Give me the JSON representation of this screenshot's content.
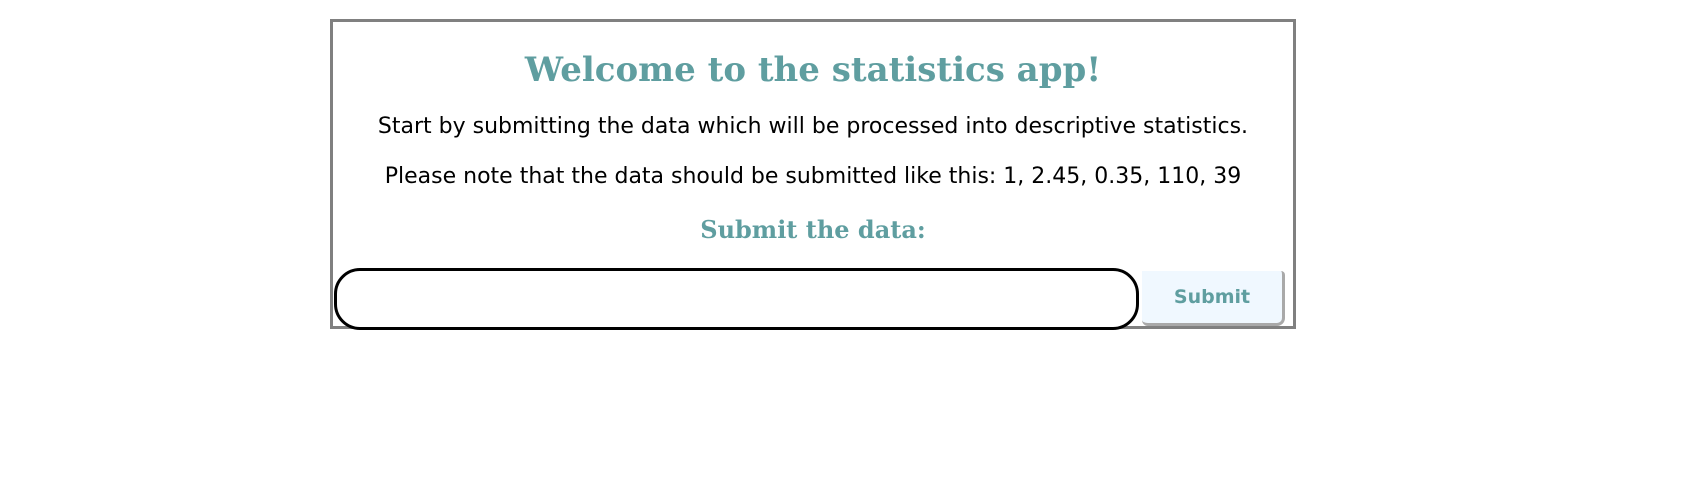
{
  "card": {
    "title": "Welcome to the statistics app!",
    "intro": "Start by submitting the data which will be processed into descriptive statistics.",
    "note": "Please note that the data should be submitted like this: 1, 2.45, 0.35, 110, 39",
    "form_title": "Submit the data:"
  },
  "form": {
    "input_value": "",
    "submit_label": "Submit"
  },
  "colors": {
    "accent": "#5f9ea0",
    "button_bg": "#f0f8ff",
    "card_border": "#808080"
  }
}
